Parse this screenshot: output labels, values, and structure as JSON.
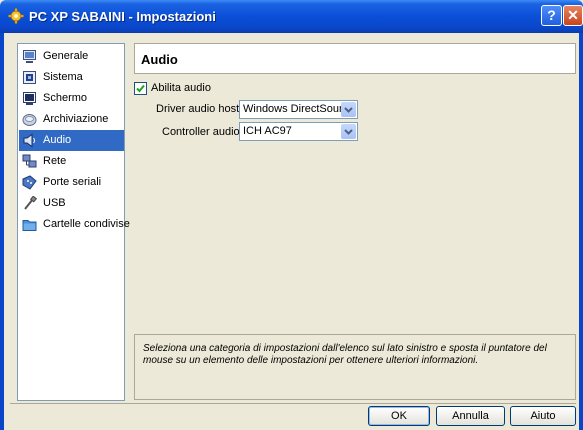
{
  "window": {
    "title": "PC XP SABAINI - Impostazioni",
    "help_glyph": "?",
    "close_glyph": "✕"
  },
  "sidebar": {
    "items": [
      {
        "label": "Generale",
        "icon": "monitor-icon"
      },
      {
        "label": "Sistema",
        "icon": "chip-icon"
      },
      {
        "label": "Schermo",
        "icon": "display-icon"
      },
      {
        "label": "Archiviazione",
        "icon": "disk-icon"
      },
      {
        "label": "Audio",
        "icon": "speaker-icon",
        "selected": true
      },
      {
        "label": "Rete",
        "icon": "network-icon"
      },
      {
        "label": "Porte seriali",
        "icon": "serial-port-icon"
      },
      {
        "label": "USB",
        "icon": "usb-icon"
      },
      {
        "label": "Cartelle condivise",
        "icon": "folder-icon"
      }
    ]
  },
  "page": {
    "title": "Audio",
    "enable_audio": {
      "label": "Abilita audio",
      "checked": true
    },
    "host_driver": {
      "label": "Driver audio host:",
      "value": "Windows DirectSound"
    },
    "controller": {
      "label": "Controller audio:",
      "value": "ICH AC97"
    },
    "info_text": "Seleziona una categoria di impostazioni dall'elenco sul lato sinistro e sposta il puntatore del mouse su un elemento delle impostazioni per ottenere ulteriori informazioni."
  },
  "buttons": {
    "ok": "OK",
    "cancel": "Annulla",
    "help": "Aiuto"
  },
  "colors": {
    "titlebar": "#0a46c9",
    "selection": "#316ac5",
    "dialog_bg": "#ece9d8"
  }
}
